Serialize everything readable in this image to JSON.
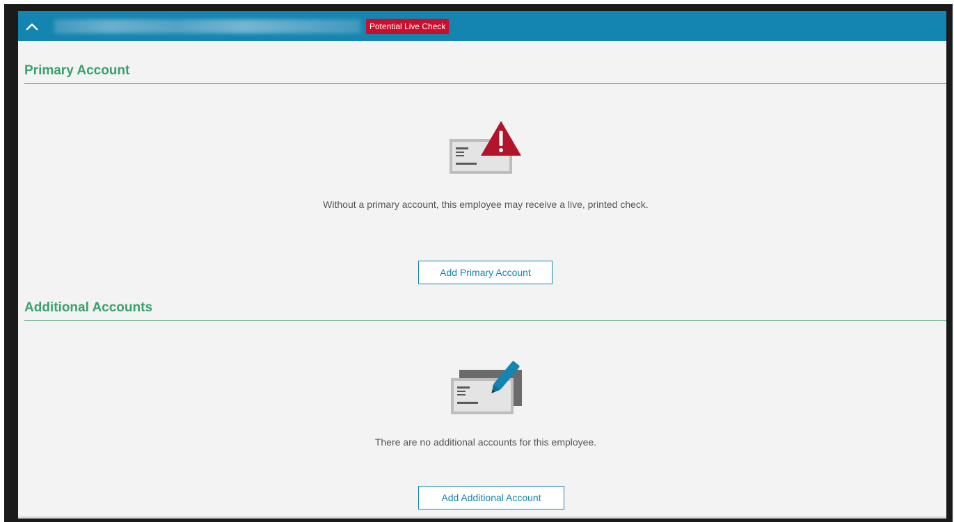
{
  "header": {
    "status_badge": "Potential Live Check",
    "collapse_icon": "chevron-up-icon"
  },
  "primary_section": {
    "title": "Primary Account",
    "icon": "check-warning-icon",
    "message": "Without a primary account, this employee may receive a live, printed check.",
    "button_label": "Add Primary Account"
  },
  "additional_section": {
    "title": "Additional Accounts",
    "icon": "checks-edit-icon",
    "message": "There are no additional accounts for this employee.",
    "button_label": "Add Additional Account"
  },
  "colors": {
    "header_blue": "#1485b0",
    "section_green": "#3aa16a",
    "alert_red": "#c8102e"
  }
}
